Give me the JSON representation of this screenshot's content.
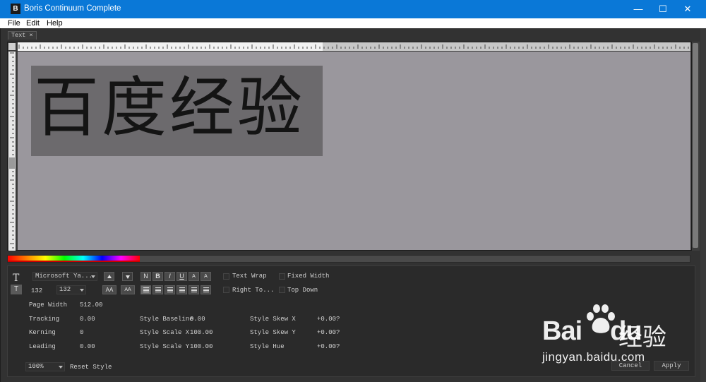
{
  "window": {
    "app_icon_letter": "B",
    "title": "Boris Continuum Complete",
    "minimize": "—",
    "maximize": "☐",
    "close": "✕"
  },
  "menu": {
    "items": [
      "File",
      "Edit",
      "Help"
    ]
  },
  "tab": {
    "label": "Text ×"
  },
  "canvas": {
    "text": "百度经验",
    "page_bg": "#9a979d",
    "selection_bg": "#6c6a6d"
  },
  "toolbar": {
    "text_tool": "T",
    "text_tool2": "T",
    "font_name": "Microsoft Ya...",
    "font_size_value": "132",
    "font_size_combo": "132",
    "bold": "B",
    "italic": "I",
    "underline": "U",
    "superscript": "A",
    "subscript": "A",
    "normal_n": "N",
    "grow_font": "AA",
    "shrink_font": "AA"
  },
  "options": {
    "text_wrap": "Text Wrap",
    "fixed_width": "Fixed Width",
    "right_to_left": "Right To...",
    "top_down": "Top Down"
  },
  "params": {
    "page_width_label": "Page Width",
    "page_width_value": "512.00",
    "tracking_label": "Tracking",
    "tracking_value": "0.00",
    "kerning_label": "Kerning",
    "kerning_value": "0",
    "leading_label": "Leading",
    "leading_value": "0.00",
    "style_baseline_label": "Style Baseline",
    "style_baseline_value": "0.00",
    "style_scale_x_label": "Style Scale X",
    "style_scale_x_value": "100.00",
    "style_scale_y_label": "Style Scale Y",
    "style_scale_y_value": "100.00",
    "style_skew_x_label": "Style Skew X",
    "style_skew_x_value": "+0.00?",
    "style_skew_y_label": "Style Skew Y",
    "style_skew_y_value": "+0.00?",
    "style_hue_label": "Style Hue",
    "style_hue_value": "+0.00?"
  },
  "footer": {
    "zoom": "100%",
    "reset_style": "Reset Style",
    "cancel": "Cancel",
    "apply": "Apply"
  },
  "watermark": {
    "logo": "Bai",
    "logo_suffix": "du",
    "cn": "经验",
    "url": "jingyan.baidu.com"
  }
}
